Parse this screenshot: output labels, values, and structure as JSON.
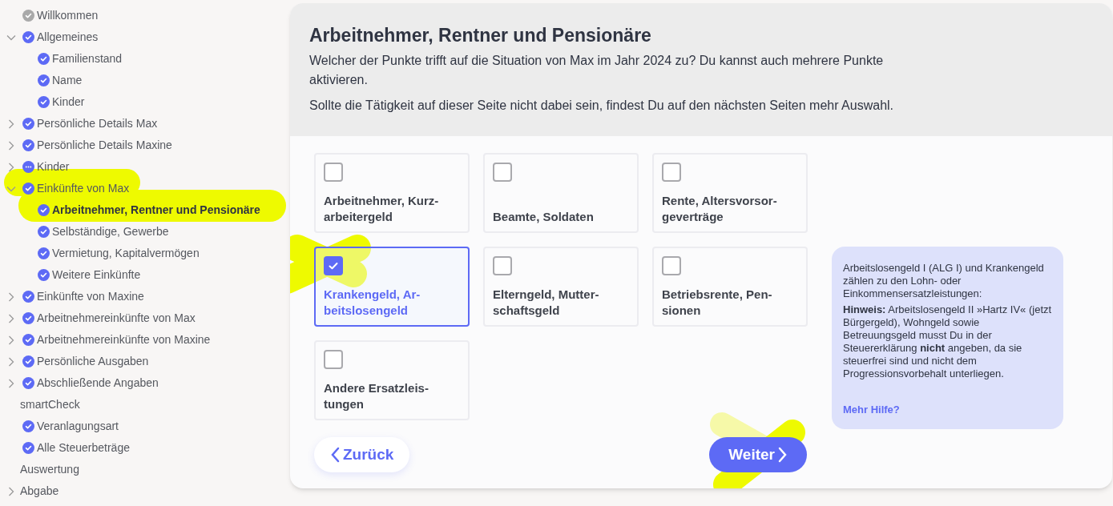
{
  "sidebar": {
    "items": [
      {
        "label": "Willkommen",
        "kind": "welcome",
        "selected": false
      },
      {
        "label": "Allgemeines",
        "kind": "done",
        "selected": false,
        "expanded": true,
        "children": [
          {
            "label": "Familienstand",
            "kind": "done",
            "selected": false
          },
          {
            "label": "Name",
            "kind": "done",
            "selected": false
          },
          {
            "label": "Kinder",
            "kind": "done",
            "selected": false
          }
        ]
      },
      {
        "label": "Persönliche Details Max",
        "kind": "done",
        "selected": false,
        "expanded": false
      },
      {
        "label": "Persönliche Details Maxine",
        "kind": "done",
        "selected": false,
        "expanded": false
      },
      {
        "label": "Kinder",
        "kind": "partial",
        "selected": false,
        "expanded": false
      },
      {
        "label": "Einkünfte von Max",
        "kind": "done",
        "selected": false,
        "expanded": true,
        "children": [
          {
            "label": "Arbeitnehmer, Rentner und Pensionäre",
            "kind": "done",
            "selected": true
          },
          {
            "label": "Selbständige, Gewerbe",
            "kind": "done",
            "selected": false
          },
          {
            "label": "Vermietung, Kapitalvermögen",
            "kind": "done",
            "selected": false
          },
          {
            "label": "Weitere Einkünfte",
            "kind": "done",
            "selected": false
          }
        ]
      },
      {
        "label": "Einkünfte von Maxine",
        "kind": "done",
        "selected": false,
        "expanded": false
      },
      {
        "label": "Arbeitnehmereinkünfte von Max",
        "kind": "done",
        "selected": false,
        "expanded": false
      },
      {
        "label": "Arbeitnehmereinkünfte von Maxine",
        "kind": "done",
        "selected": false,
        "expanded": false
      },
      {
        "label": "Persönliche Ausgaben",
        "kind": "done",
        "selected": false,
        "expanded": false
      },
      {
        "label": "Abschließende Angaben",
        "kind": "done",
        "selected": false,
        "expanded": false
      },
      {
        "label": "smartCheck",
        "kind": "plain",
        "selected": false
      },
      {
        "label": "Veranlagungsart",
        "kind": "done",
        "selected": false
      },
      {
        "label": "Alle Steuerbeträge",
        "kind": "done",
        "selected": false
      },
      {
        "label": "Auswertung",
        "kind": "plain",
        "selected": false
      },
      {
        "label": "Abgabe",
        "kind": "plain",
        "selected": false,
        "expanded": false
      }
    ]
  },
  "header": {
    "title": "Arbeitnehmer, Rentner und Pensionäre",
    "question": "Welcher der Punkte trifft auf die Situation von Max im Jahr 2024 zu? Du kannst auch mehrere Punkte aktivieren.",
    "note": "Sollte die Tätigkeit auf dieser Seite nicht dabei sein, findest Du auf den nächsten Seiten mehr Auswahl."
  },
  "options": [
    {
      "label": "Arbeitnehmer, Kurz-\narbeitergeld",
      "checked": false
    },
    {
      "label": "Beamte, Soldaten",
      "checked": false
    },
    {
      "label": "Rente, Altersvorsor-\ngeverträge",
      "checked": false
    },
    {
      "label": "Krankengeld, Ar-\nbeitslosengeld",
      "checked": true
    },
    {
      "label": "Elterngeld, Mutter-\nschaftsgeld",
      "checked": false
    },
    {
      "label": "Betriebsrente, Pen-\nsionen",
      "checked": false
    },
    {
      "label": "Andere Ersatzleis-\ntungen",
      "checked": false
    }
  ],
  "help": {
    "intro": "Arbeitslosengeld I (ALG I) und Krankengeld zählen zu den Lohn- oder Einkommensersatzleistungen:",
    "hint": "**Hinweis:** Arbeitslosengeld II »Hartz IV« (jetzt Bürgergeld), Wohngeld sowie Betreuungsgeld musst Du in der Steuererklärung **nicht** angeben, da sie steuerfrei sind und nicht dem Progressionsvorbehalt unterliegen.",
    "link": "Mehr Hilfe?"
  },
  "buttons": {
    "back": "Zurück",
    "next": "Weiter"
  }
}
